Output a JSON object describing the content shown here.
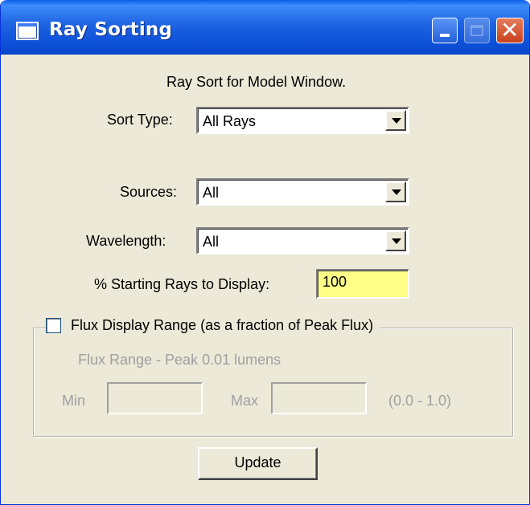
{
  "window": {
    "title": "Ray Sorting",
    "controls": [
      "minimize-icon",
      "maximize-icon",
      "close-icon"
    ]
  },
  "header_text": "Ray Sort for Model Window.",
  "sort_type": {
    "label": "Sort Type:",
    "value": "All Rays"
  },
  "sources": {
    "label": "Sources:",
    "value": "All"
  },
  "wavelength": {
    "label": "Wavelength:",
    "value": "All"
  },
  "starting_rays": {
    "label": "% Starting Rays to Display:",
    "value": "100"
  },
  "flux_group": {
    "checkbox_label": "Flux Display Range (as a fraction of Peak Flux)",
    "checked": false,
    "range_text": "Flux Range - Peak 0.01 lumens",
    "min_label": "Min",
    "min_value": "",
    "max_label": "Max",
    "max_value": "",
    "range_hint": "(0.0 - 1.0)"
  },
  "update_button": "Update",
  "colors": {
    "titlebar": "#0A5FE8",
    "dialog_bg": "#ECE9D8",
    "highlight_input": "#FFFF88",
    "close_button": "#D9542B"
  }
}
